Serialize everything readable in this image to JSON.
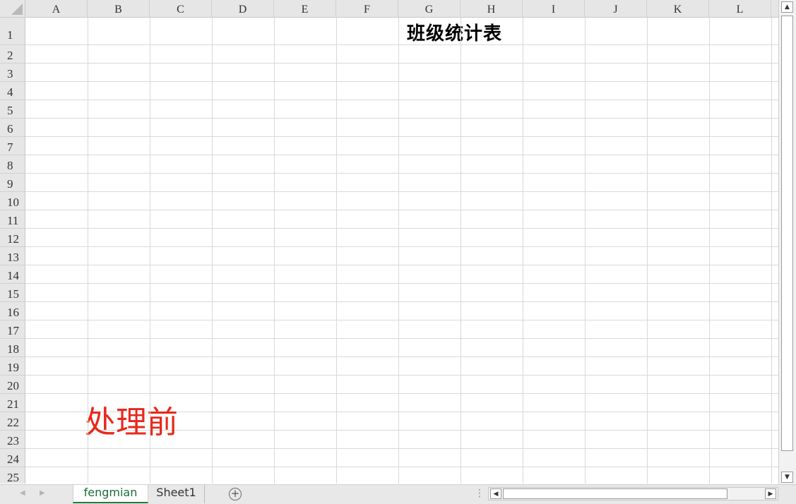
{
  "columns": [
    "A",
    "B",
    "C",
    "D",
    "E",
    "F",
    "G",
    "H",
    "I",
    "J",
    "K",
    "L"
  ],
  "rows": [
    "1",
    "2",
    "3",
    "4",
    "5",
    "6",
    "7",
    "8",
    "9",
    "10",
    "11",
    "12",
    "13",
    "14",
    "15",
    "16",
    "17",
    "18",
    "19",
    "20",
    "21",
    "22",
    "23",
    "24",
    "25"
  ],
  "cells": {
    "title": "班级统计表",
    "note": "处理前"
  },
  "sheets": {
    "tabs": [
      {
        "label": "fengmian",
        "active": true
      },
      {
        "label": "Sheet1",
        "active": false
      }
    ],
    "add_symbol": "+"
  },
  "colors": {
    "note_text": "#e8281b",
    "active_tab_text": "#1c6b36",
    "active_tab_underline": "#1e7a3c",
    "header_bg": "#e6e6e6"
  },
  "icons": {
    "select_all": "select-all-triangle-icon",
    "scroll_up": "arrow-up-icon",
    "scroll_down": "arrow-down-icon",
    "scroll_left": "arrow-left-icon",
    "scroll_right": "arrow-right-icon",
    "add_sheet": "plus-circle-icon"
  }
}
